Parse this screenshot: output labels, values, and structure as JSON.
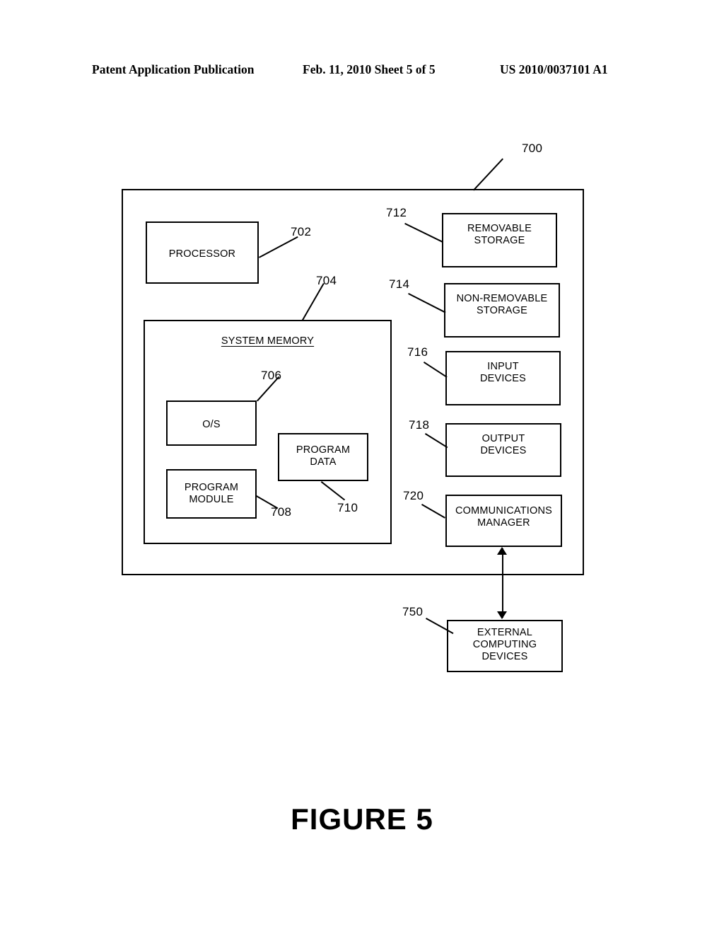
{
  "header": {
    "left": "Patent Application Publication",
    "middle": "Feb. 11, 2010  Sheet 5 of 5",
    "right": "US 2010/0037101 A1"
  },
  "caption": "FIGURE 5",
  "diagram": {
    "system_ref": "700",
    "boxes": {
      "processor": {
        "label": "PROCESSOR",
        "ref": "702"
      },
      "system_memory": {
        "label": "SYSTEM MEMORY",
        "ref": "704"
      },
      "os": {
        "label": "O/S",
        "ref": "706"
      },
      "program_module": {
        "label_line1": "PROGRAM",
        "label_line2": "MODULE",
        "ref": "708"
      },
      "program_data": {
        "label_line1": "PROGRAM",
        "label_line2": "DATA",
        "ref": "710"
      },
      "removable_storage": {
        "label_line1": "REMOVABLE",
        "label_line2": "STORAGE",
        "ref": "712"
      },
      "non_removable_storage": {
        "label_line1": "NON-REMOVABLE",
        "label_line2": "STORAGE",
        "ref": "714"
      },
      "input_devices": {
        "label_line1": "INPUT",
        "label_line2": "DEVICES",
        "ref": "716"
      },
      "output_devices": {
        "label_line1": "OUTPUT",
        "label_line2": "DEVICES",
        "ref": "718"
      },
      "communications_manager": {
        "label_line1": "COMMUNICATIONS",
        "label_line2": "MANAGER",
        "ref": "720"
      },
      "external_computing_devices": {
        "label_line1": "EXTERNAL",
        "label_line2": "COMPUTING",
        "label_line3": "DEVICES",
        "ref": "750"
      }
    }
  },
  "colors": {
    "line": "#000000",
    "background": "#ffffff"
  }
}
